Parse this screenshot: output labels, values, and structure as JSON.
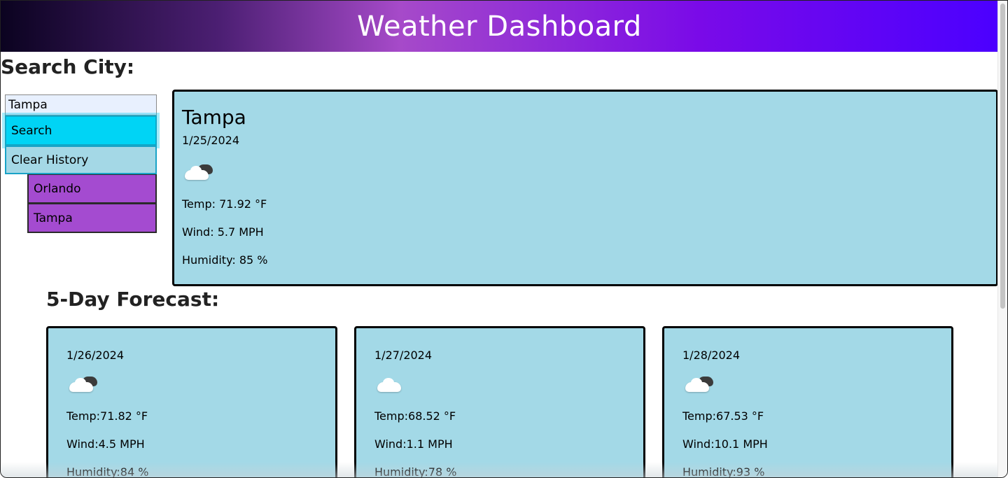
{
  "header": {
    "title": "Weather Dashboard"
  },
  "search": {
    "title": "Search City:",
    "input_value": "Tampa",
    "search_label": "Search",
    "clear_label": "Clear History",
    "history": [
      "Orlando",
      "Tampa"
    ]
  },
  "current": {
    "city": "Tampa",
    "date": "1/25/2024",
    "icon": "cloud-icon",
    "temp": "Temp: 71.92 °F",
    "wind": "Wind: 5.7 MPH",
    "humidity": "Humidity: 85 %"
  },
  "forecast": {
    "title": "5-Day Forecast:",
    "days": [
      {
        "date": "1/26/2024",
        "icon": "cloud-icon",
        "temp": "Temp:71.82 °F",
        "wind": "Wind:4.5 MPH",
        "humidity": "Humidity:84 %"
      },
      {
        "date": "1/27/2024",
        "icon": "cloud-icon",
        "temp": "Temp:68.52 °F",
        "wind": "Wind:1.1 MPH",
        "humidity": "Humidity:78 %"
      },
      {
        "date": "1/28/2024",
        "icon": "cloud-icon",
        "temp": "Temp:67.53 °F",
        "wind": "Wind:10.1 MPH",
        "humidity": "Humidity:93 %"
      }
    ]
  },
  "colors": {
    "card_bg": "#a3d9e7",
    "search_button": "#00d4f5",
    "history_item": "#a44bd0"
  }
}
